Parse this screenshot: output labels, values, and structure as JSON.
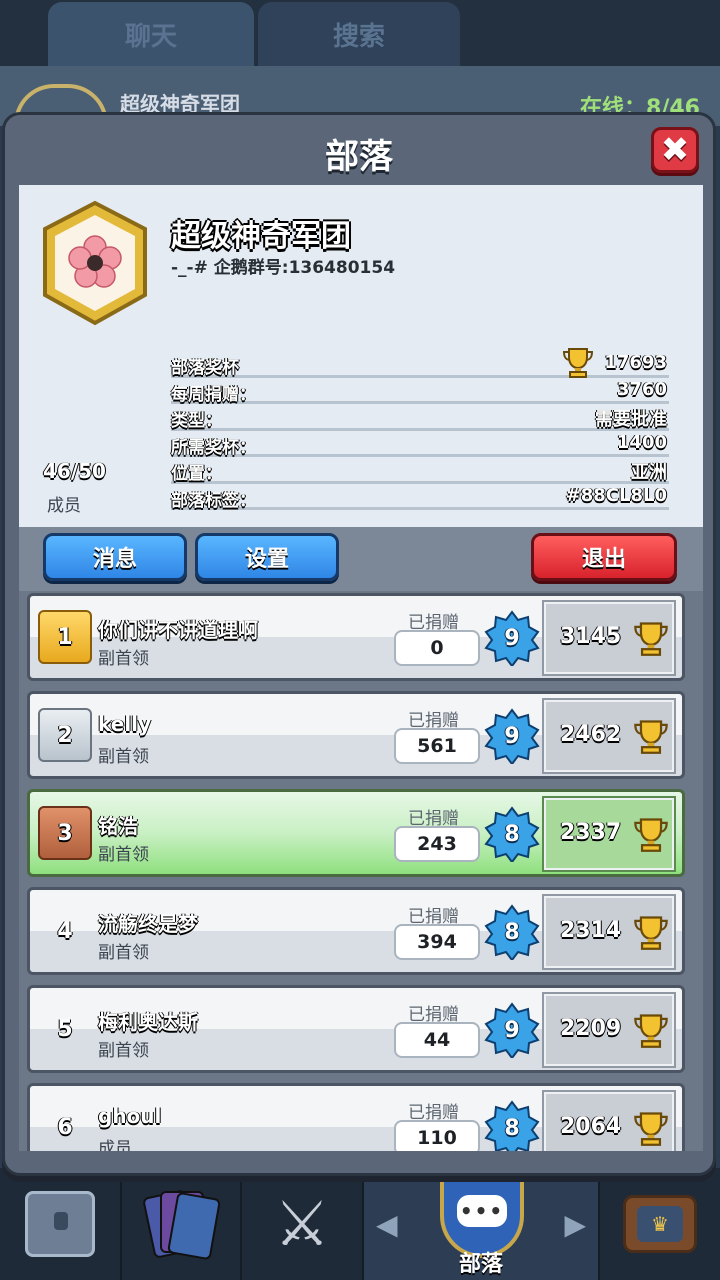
{
  "background": {
    "tabs": [
      "聊天",
      "搜索"
    ],
    "clan_name": "超级神奇军团",
    "online": "在线：8/46"
  },
  "modal": {
    "title": "部落",
    "close_label": "✖"
  },
  "clan": {
    "name": "超级神奇军团",
    "description": "-_-# 企鹅群号:136480154",
    "members_count": "46/50",
    "members_label": "成员",
    "stats": [
      {
        "label": "部落奖杯",
        "value": "17693",
        "icon": "trophy-icon"
      },
      {
        "label": "每周捐赠：",
        "value": "3760"
      },
      {
        "label": "类型：",
        "value": "需要批准"
      },
      {
        "label": "所需奖杯：",
        "value": "1400"
      },
      {
        "label": "位置：",
        "value": "亚洲"
      },
      {
        "label": "部落标签：",
        "value": "#88CL8L0"
      }
    ]
  },
  "actions": {
    "message": "消息",
    "settings": "设置",
    "exit": "退出"
  },
  "donated_label": "已捐赠",
  "members": [
    {
      "rank": "1",
      "rank_style": "gold",
      "name": "你们讲不讲道理啊",
      "role": "副首领",
      "donated": "0",
      "level": "9",
      "trophies": "3145"
    },
    {
      "rank": "2",
      "rank_style": "silver",
      "name": "kelly",
      "role": "副首领",
      "donated": "561",
      "level": "9",
      "trophies": "2462"
    },
    {
      "rank": "3",
      "rank_style": "bronze",
      "name": "铭浩",
      "role": "副首领",
      "donated": "243",
      "level": "8",
      "trophies": "2337",
      "highlight": true
    },
    {
      "rank": "4",
      "rank_style": "plain",
      "name": "流觞终是梦",
      "role": "副首领",
      "donated": "394",
      "level": "8",
      "trophies": "2314"
    },
    {
      "rank": "5",
      "rank_style": "plain",
      "name": "梅利奥达斯",
      "role": "副首领",
      "donated": "44",
      "level": "9",
      "trophies": "2209"
    },
    {
      "rank": "6",
      "rank_style": "plain",
      "name": "ghoul",
      "role": "成员",
      "donated": "110",
      "level": "8",
      "trophies": "2064"
    }
  ],
  "bottom_nav": {
    "items": [
      "chest-icon",
      "cards-icon",
      "swords-icon",
      "clan-icon",
      "tv-icon"
    ],
    "active_label": "部落"
  },
  "colors": {
    "accent_blue": "#2f86e6",
    "exit_red": "#d8222c",
    "highlight_green": "#8fe07e",
    "gold": "#e8a91e"
  }
}
